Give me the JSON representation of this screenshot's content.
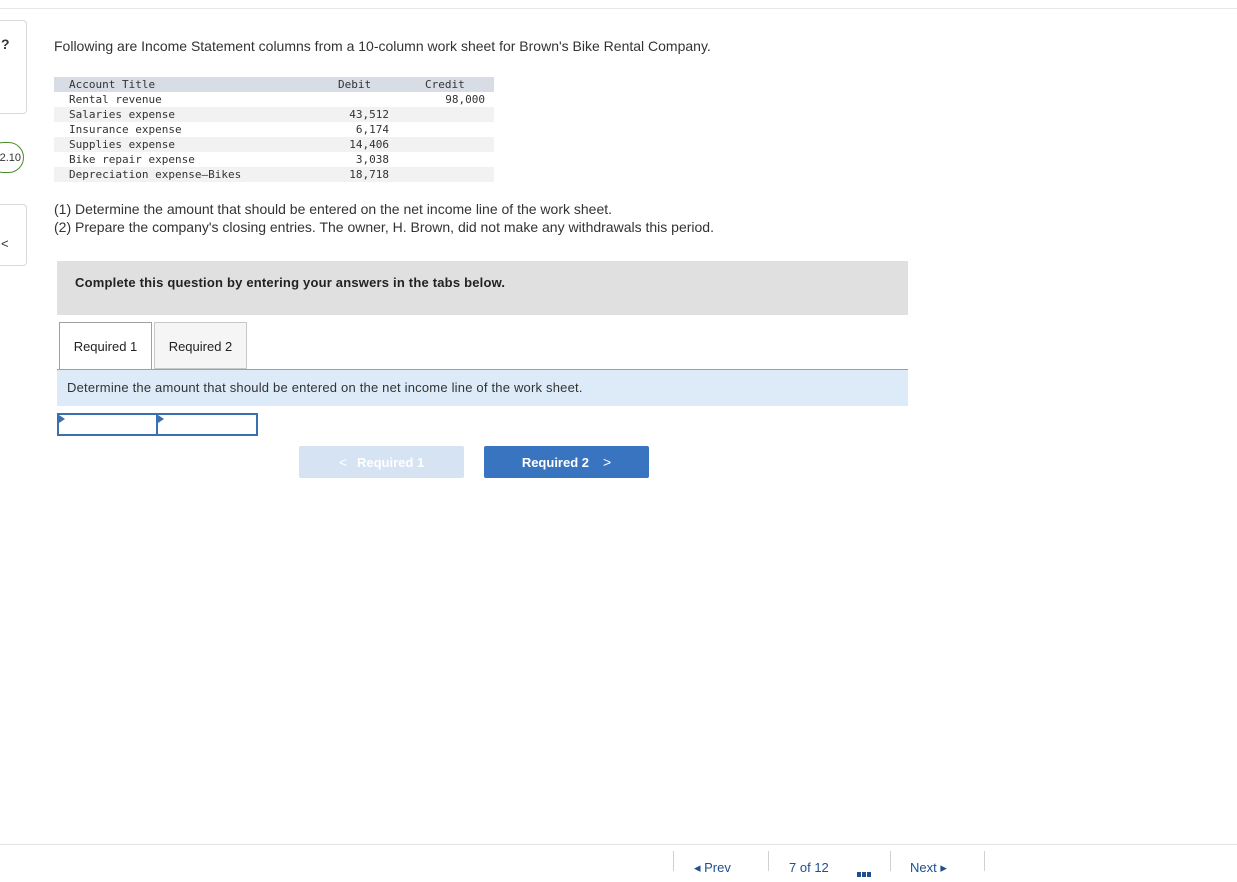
{
  "side": {
    "glyph_top": "?",
    "score": "2.10",
    "glyph_bottom": "<"
  },
  "intro": "Following are Income Statement columns from a 10-column work sheet for Brown's Bike Rental Company.",
  "worksheet": {
    "headers": {
      "title": "Account Title",
      "debit": "Debit",
      "credit": "Credit"
    },
    "rows": [
      {
        "title": "Rental revenue",
        "debit": "",
        "credit": "98,000"
      },
      {
        "title": "Salaries expense",
        "debit": "43,512",
        "credit": ""
      },
      {
        "title": "Insurance expense",
        "debit": "6,174",
        "credit": ""
      },
      {
        "title": "Supplies expense",
        "debit": "14,406",
        "credit": ""
      },
      {
        "title": "Bike repair expense",
        "debit": "3,038",
        "credit": ""
      },
      {
        "title": "Depreciation expense—Bikes",
        "debit": "18,718",
        "credit": ""
      }
    ]
  },
  "questions": {
    "q1_num": "(1)",
    "q1_text": " Determine the amount that should be entered on the net income line of the work sheet.",
    "q2_num": "(2)",
    "q2_text": " Prepare the company's closing entries. The owner, H. Brown, did not make any withdrawals this period."
  },
  "banner": "Complete this question by entering your answers in the tabs below.",
  "tabs": [
    {
      "label": "Required 1",
      "active": true
    },
    {
      "label": "Required 2",
      "active": false
    }
  ],
  "instruction": "Determine the amount that should be entered on the net income line of the work sheet.",
  "answer_fields": [
    "",
    ""
  ],
  "nav": {
    "prev_label": "Required 1",
    "next_label": "Required 2",
    "prev_chevron": "<",
    "next_chevron": ">"
  },
  "footer": {
    "prev_label": "Prev",
    "page_current": "7",
    "page_of": "of",
    "page_total": "12",
    "next_label": "Next"
  },
  "colors": {
    "accent": "#3874bf",
    "accent_disabled": "#d6e3f2",
    "instruction_bg": "#dcebf7",
    "banner_bg": "#e0e0e0",
    "score_border": "#4a8c2a"
  }
}
